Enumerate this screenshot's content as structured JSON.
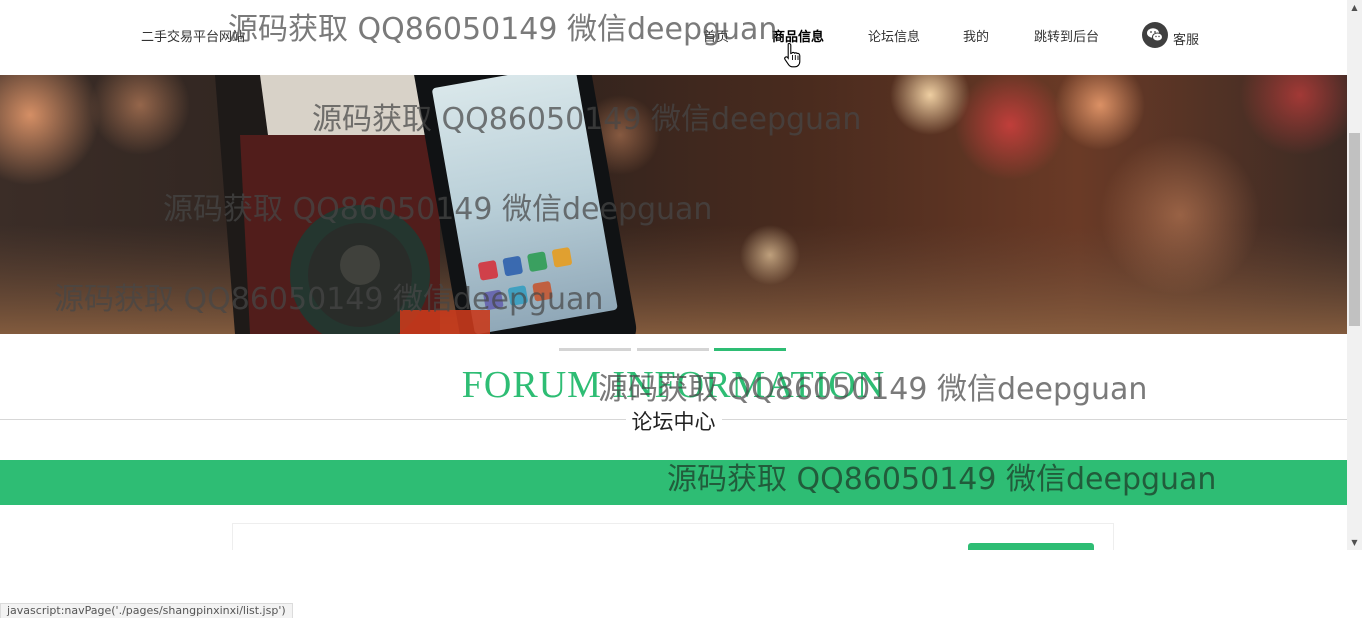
{
  "header": {
    "site_title": "二手交易平台网站",
    "nav": [
      {
        "label": "首页",
        "active": false
      },
      {
        "label": "商品信息",
        "active": true
      },
      {
        "label": "论坛信息",
        "active": false
      },
      {
        "label": "我的",
        "active": false
      },
      {
        "label": "跳转到后台",
        "active": false
      }
    ],
    "service": {
      "label": "客服",
      "icon": "wechat-icon"
    }
  },
  "carousel": {
    "slide_count": 3,
    "active_index": 2
  },
  "section": {
    "title_en": "FORUM INFORMATION",
    "title_cn": "论坛中心"
  },
  "watermark": "源码获取 QQ86050149 微信deepguan",
  "status_bar": {
    "text": "javascript:navPage('./pages/shangpinxinxi/list.jsp')"
  },
  "colors": {
    "accent": "#2ebd74",
    "text": "#333333"
  },
  "scrollbar": {
    "up_icon": "▲",
    "down_icon": "▼"
  }
}
